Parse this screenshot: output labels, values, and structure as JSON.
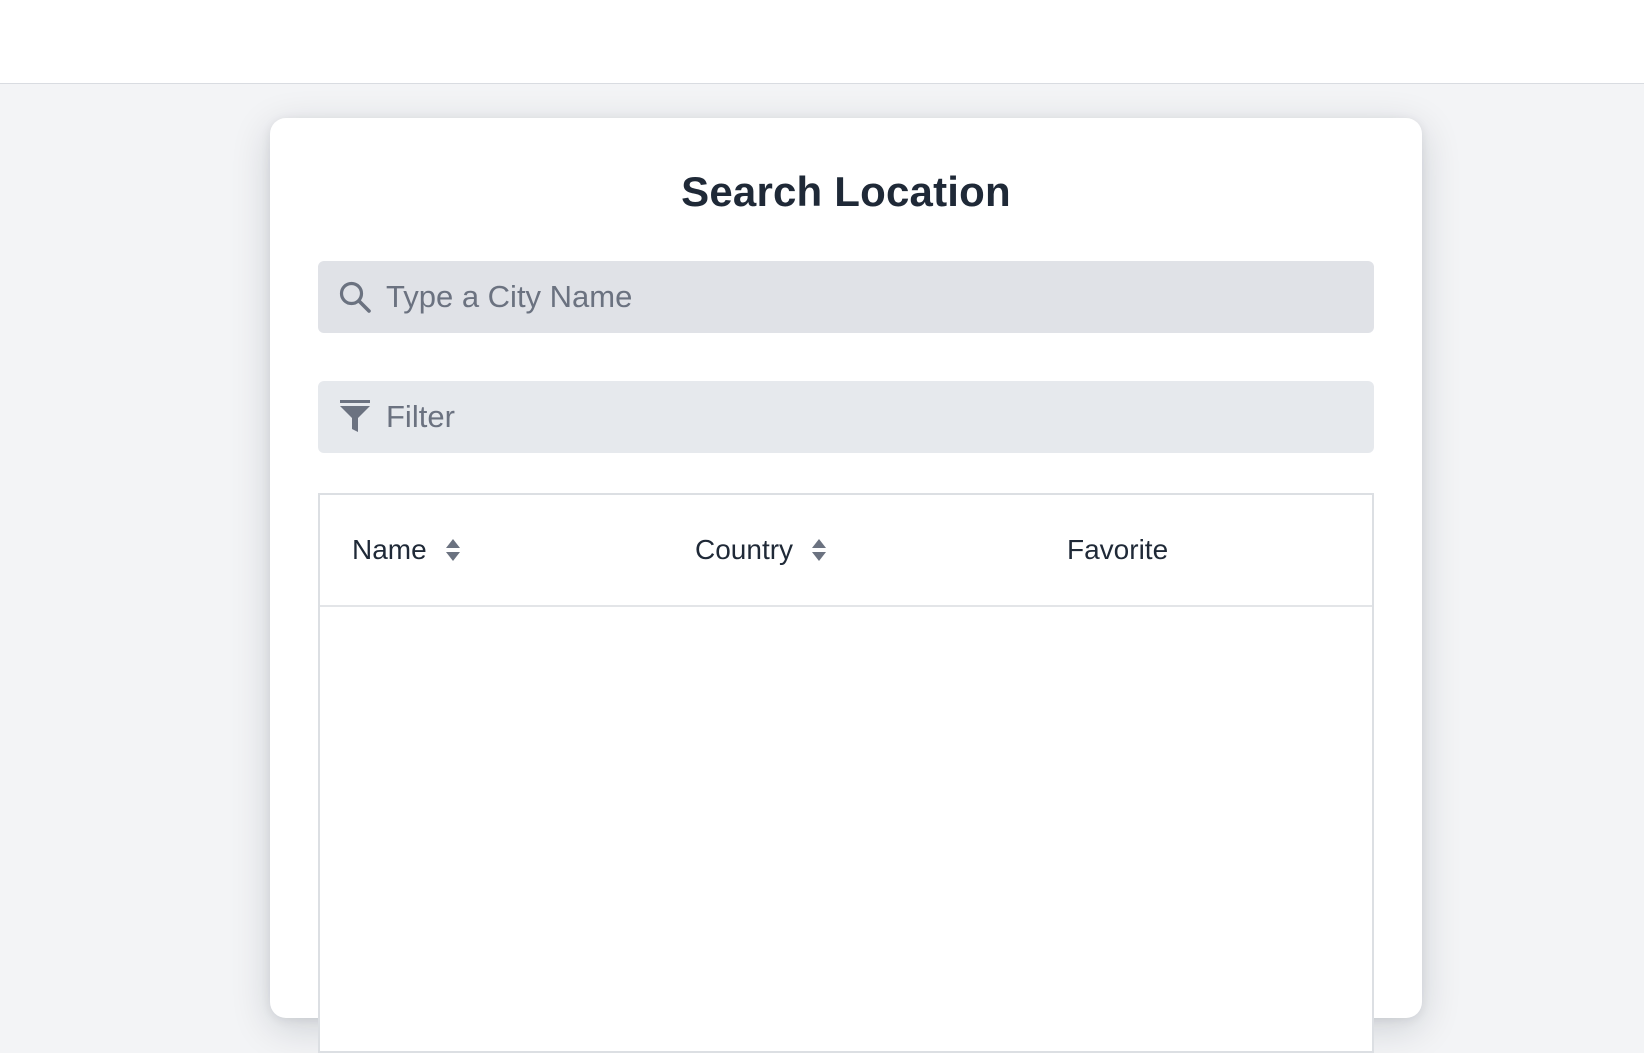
{
  "page": {
    "title": "Search Location"
  },
  "search": {
    "placeholder": "Type a City Name",
    "icon": "search-icon"
  },
  "filter": {
    "placeholder": "Filter",
    "icon": "filter-icon"
  },
  "table": {
    "columns": [
      {
        "label": "Name",
        "sortable": true
      },
      {
        "label": "Country",
        "sortable": true
      },
      {
        "label": "Favorite",
        "sortable": false
      }
    ],
    "rows": []
  },
  "colors": {
    "background": "#f3f4f6",
    "card": "#ffffff",
    "search_field": "#e0e2e7",
    "filter_field": "#e6e9ed",
    "title_text": "#1f2937",
    "placeholder_text": "#6b7280",
    "icon": "#6b7280"
  }
}
